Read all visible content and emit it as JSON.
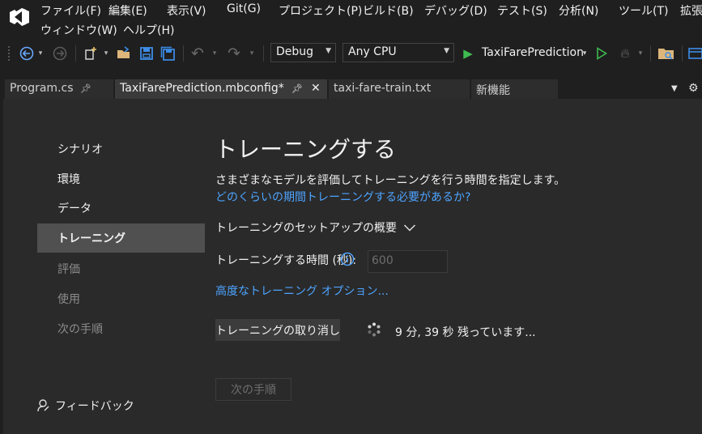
{
  "menu": {
    "items": [
      "ファイル(F)",
      "編集(E)",
      "表示(V)",
      "Git(G)",
      "プロジェクト(P)",
      "ビルド(B)",
      "デバッグ(D)",
      "テスト(S)",
      "分析(N)",
      "ツール(T)",
      "拡張"
    ],
    "row2": [
      "ウィンドウ(W)",
      "ヘルプ(H)"
    ]
  },
  "toolbar": {
    "config": "Debug",
    "platform": "Any CPU",
    "run_target": "TaxiFarePrediction"
  },
  "tabs": [
    {
      "label": "Program.cs",
      "active": false
    },
    {
      "label": "TaxiFarePrediction.mbconfig*",
      "active": true
    },
    {
      "label": "taxi-fare-train.txt",
      "active": false
    },
    {
      "label": "新機能",
      "active": false
    }
  ],
  "sidebar": {
    "items": [
      {
        "label": "シナリオ",
        "state": "normal"
      },
      {
        "label": "環境",
        "state": "normal"
      },
      {
        "label": "データ",
        "state": "normal"
      },
      {
        "label": "トレーニング",
        "state": "selected"
      },
      {
        "label": "評価",
        "state": "disabled"
      },
      {
        "label": "使用",
        "state": "disabled"
      },
      {
        "label": "次の手順",
        "state": "disabled"
      }
    ],
    "feedback": "フィードバック"
  },
  "main": {
    "title": "トレーニングする",
    "description": "さまざまなモデルを評価してトレーニングを行う時間を指定します。",
    "help_link": "どのくらいの期間トレーニングする必要があるか?",
    "setup_summary": "トレーニングのセットアップの概要",
    "time_label": "トレーニングする時間 (秒):",
    "time_value": "600",
    "advanced_link": "高度なトレーニング オプション...",
    "cancel_button": "トレーニングの取り消し",
    "status": "9 分, 39 秒 残っています...",
    "next_button": "次の手順"
  },
  "colors": {
    "accent_link": "#4da3ff",
    "run_green": "#3fb950",
    "save_blue": "#3c8ce7",
    "nav_selected": "#505050"
  }
}
